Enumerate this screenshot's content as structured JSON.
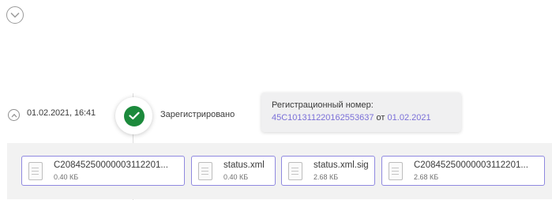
{
  "header": {
    "toggle_icon": "chevron-down-icon"
  },
  "event": {
    "datetime": "01.02.2021, 16:41",
    "toggle_icon": "chevron-up-icon",
    "status_icon": "check-icon",
    "status_color": "#1c8a3c",
    "status_label": "Зарегистрировано"
  },
  "registration": {
    "title": "Регистрационный номер:",
    "number": "45C101311220162553637",
    "date_prefix": "от",
    "date": "01.02.2021",
    "link_color": "#7a6fd8"
  },
  "files": [
    {
      "name": "C20845250000003112201...",
      "size": "0.40 КБ",
      "icon": "document-icon"
    },
    {
      "name": "status.xml",
      "size": "0.40 КБ",
      "icon": "document-icon"
    },
    {
      "name": "status.xml.sig",
      "size": "2.68 КБ",
      "icon": "document-icon"
    },
    {
      "name": "C20845250000003112201...",
      "size": "2.68 КБ",
      "icon": "document-icon"
    }
  ]
}
